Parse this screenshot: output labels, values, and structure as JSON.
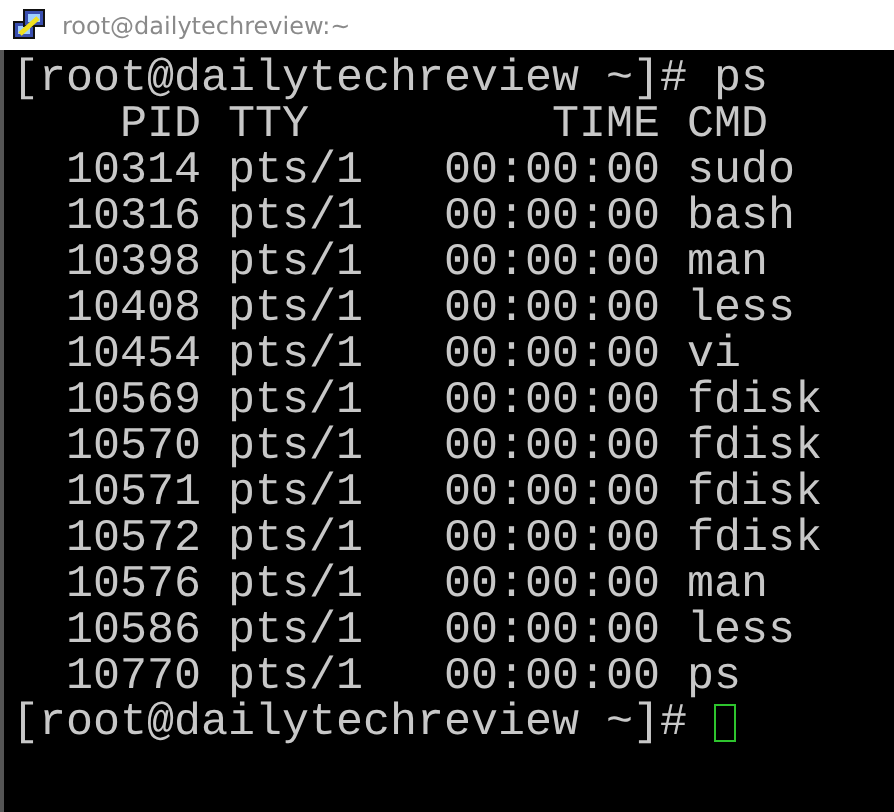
{
  "window": {
    "title": "root@dailytechreview:~"
  },
  "terminal": {
    "command_line": {
      "prompt": "[root@dailytechreview ~]#",
      "command": "ps"
    },
    "columns": [
      "PID",
      "TTY",
      "TIME",
      "CMD"
    ],
    "rows": [
      [
        "10314",
        "pts/1",
        "00:00:00",
        "sudo"
      ],
      [
        "10316",
        "pts/1",
        "00:00:00",
        "bash"
      ],
      [
        "10398",
        "pts/1",
        "00:00:00",
        "man"
      ],
      [
        "10408",
        "pts/1",
        "00:00:00",
        "less"
      ],
      [
        "10454",
        "pts/1",
        "00:00:00",
        "vi"
      ],
      [
        "10569",
        "pts/1",
        "00:00:00",
        "fdisk"
      ],
      [
        "10570",
        "pts/1",
        "00:00:00",
        "fdisk"
      ],
      [
        "10571",
        "pts/1",
        "00:00:00",
        "fdisk"
      ],
      [
        "10572",
        "pts/1",
        "00:00:00",
        "fdisk"
      ],
      [
        "10576",
        "pts/1",
        "00:00:00",
        "man"
      ],
      [
        "10586",
        "pts/1",
        "00:00:00",
        "less"
      ],
      [
        "10770",
        "pts/1",
        "00:00:00",
        "ps"
      ]
    ],
    "prompt_line": {
      "prompt": "[root@dailytechreview ~]#"
    }
  }
}
